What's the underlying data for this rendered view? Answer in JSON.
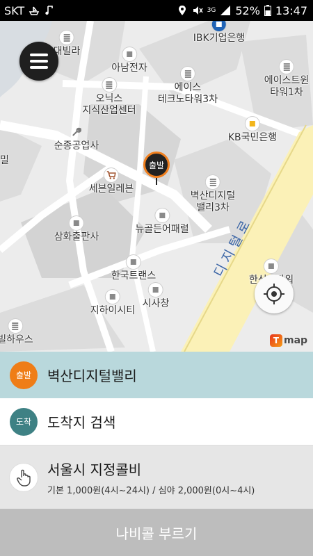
{
  "status_bar": {
    "carrier": "SKT",
    "network": "3G",
    "battery": "52%",
    "time": "13:47",
    "icons": [
      "boat-icon",
      "music-note-icon",
      "location-icon",
      "mute-icon",
      "data-icon",
      "signal-icon",
      "battery-icon"
    ]
  },
  "map": {
    "pois": [
      {
        "label": "대빌라",
        "icon": "building-icon"
      },
      {
        "label": "아남전자",
        "icon": "poi-square-icon"
      },
      {
        "label": "IBK기업은행",
        "icon": "bank-icon"
      },
      {
        "label": "에이스\n테크노타워3차",
        "icon": "building-icon"
      },
      {
        "label": "에이스트윈\n타워1차",
        "icon": "building-icon"
      },
      {
        "label": "오닉스\n지식산업센터",
        "icon": "building-icon"
      },
      {
        "label": "KB국민은행",
        "icon": "bank-icon"
      },
      {
        "label": "순종공업사",
        "icon": "wrench-icon"
      },
      {
        "label": "세븐일레븐",
        "icon": "cart-icon"
      },
      {
        "label": "벽산디지털\n밸리3차",
        "icon": "building-icon"
      },
      {
        "label": "삼화출판사",
        "icon": "poi-square-icon"
      },
      {
        "label": "뉴골든어패럴",
        "icon": "poi-square-icon"
      },
      {
        "label": "한국트랜스",
        "icon": "poi-square-icon"
      },
      {
        "label": "시사창",
        "icon": "poi-square-icon"
      },
      {
        "label": "한신IT타워",
        "icon": "poi-square-icon"
      },
      {
        "label": "지하이시티",
        "icon": "poi-square-icon"
      },
      {
        "label": "빌하우스",
        "icon": "building-icon"
      }
    ],
    "edge_label_left": "밀",
    "road_name": "디지털로",
    "pin_label": "출발",
    "brand": "map"
  },
  "panel": {
    "origin": {
      "badge": "출발",
      "text": "벽산디지털밸리"
    },
    "destination": {
      "badge": "도착",
      "placeholder": "도착지 검색"
    },
    "fare": {
      "title": "서울시 지정콜비",
      "description": "기본 1,000원(4시~24시) / 심야 2,000원(0시~4시)"
    },
    "call_button": "나비콜 부르기"
  },
  "colors": {
    "origin_badge": "#ef7d17",
    "destination_badge": "#3e8184",
    "origin_row_bg": "#b9d8dc",
    "call_button_bg": "#bdbdbd"
  }
}
